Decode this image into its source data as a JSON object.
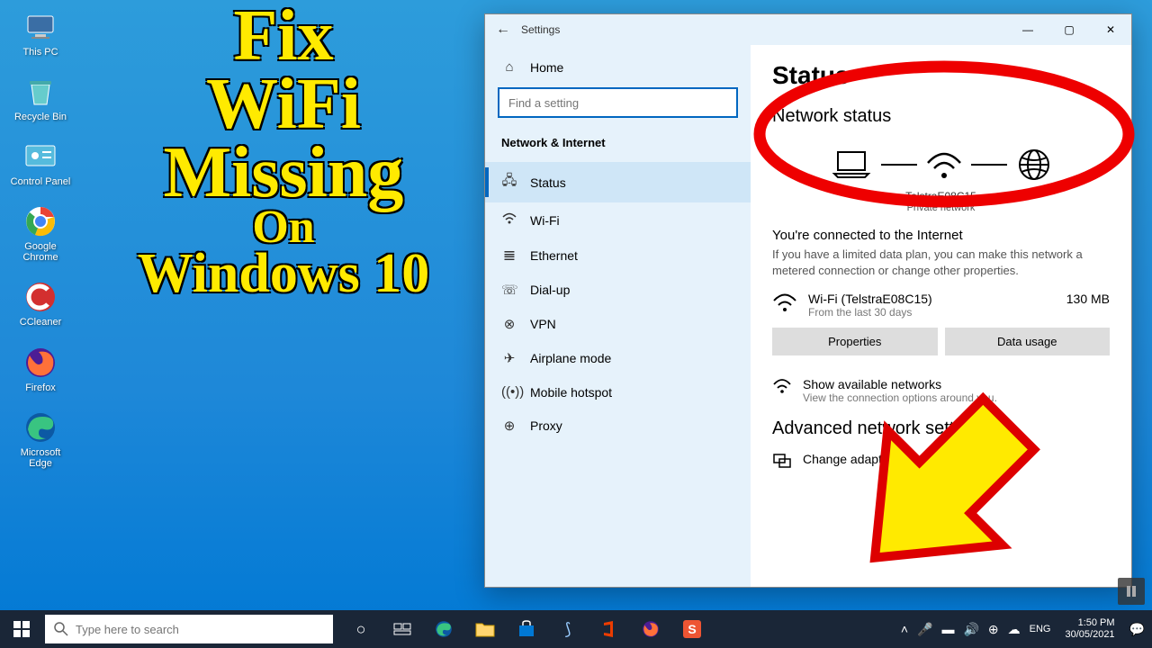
{
  "desktop_icons": [
    {
      "label": "This PC",
      "id": "this-pc"
    },
    {
      "label": "Recycle Bin",
      "id": "recycle-bin"
    },
    {
      "label": "Control Panel",
      "id": "control-panel"
    },
    {
      "label": "Google Chrome",
      "id": "chrome"
    },
    {
      "label": "CCleaner",
      "id": "ccleaner"
    },
    {
      "label": "Firefox",
      "id": "firefox"
    },
    {
      "label": "Microsoft Edge",
      "id": "edge"
    }
  ],
  "overlay": {
    "line1": "Fix",
    "line2": "WiFi",
    "line3": "Missing",
    "line4": "On",
    "line5": "Windows 10"
  },
  "settings": {
    "title": "Settings",
    "home": "Home",
    "search_placeholder": "Find a setting",
    "section": "Network & Internet",
    "nav": {
      "status": "Status",
      "wifi": "Wi-Fi",
      "ethernet": "Ethernet",
      "dialup": "Dial-up",
      "vpn": "VPN",
      "airplane": "Airplane mode",
      "hotspot": "Mobile hotspot",
      "proxy": "Proxy"
    },
    "content": {
      "heading": "Status",
      "subheading": "Network status",
      "network_name": "TelstraE08C15",
      "network_type": "Private network",
      "connected_title": "You're connected to the Internet",
      "connected_desc": "If you have a limited data plan, you can make this network a metered connection or change other properties.",
      "adapter_name": "Wi-Fi (TelstraE08C15)",
      "adapter_period": "From the last 30 days",
      "data_amount": "130 MB",
      "btn_properties": "Properties",
      "btn_data_usage": "Data usage",
      "show_networks": "Show available networks",
      "show_networks_desc": "View the connection options around you.",
      "advanced_heading": "Advanced network settings",
      "change_adapter": "Change adapter options"
    }
  },
  "taskbar": {
    "search_placeholder": "Type here to search",
    "lang": "ENG",
    "time": "1:50 PM",
    "date": "30/05/2021"
  }
}
